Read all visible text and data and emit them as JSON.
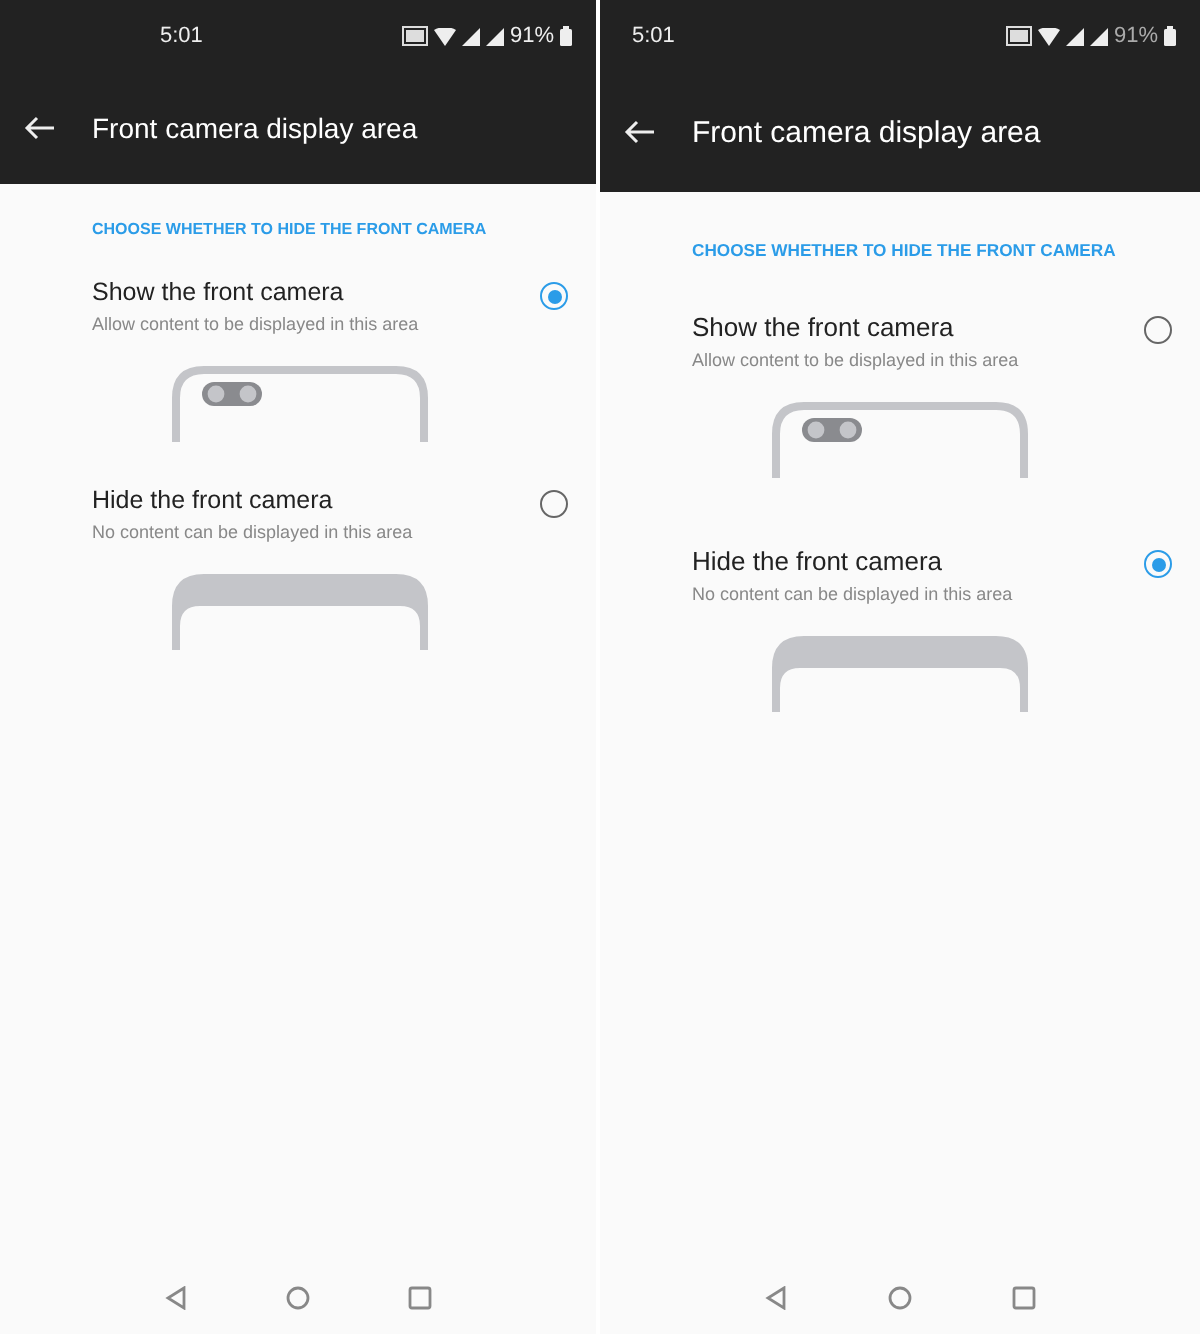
{
  "screens": [
    {
      "status_bar": {
        "time": "5:01",
        "battery": "91%"
      },
      "app_bar": {
        "title": "Front camera display area"
      },
      "section_header": "CHOOSE WHETHER TO HIDE THE FRONT CAMERA",
      "options": [
        {
          "kind": "show",
          "title": "Show the front camera",
          "subtitle": "Allow content to be displayed in this area",
          "selected": true
        },
        {
          "kind": "hide",
          "title": "Hide the front camera",
          "subtitle": "No content can be displayed in this area",
          "selected": false
        }
      ]
    },
    {
      "status_bar": {
        "time": "5:01",
        "battery": "91%"
      },
      "app_bar": {
        "title": "Front camera display area"
      },
      "section_header": "CHOOSE WHETHER TO HIDE THE FRONT CAMERA",
      "options": [
        {
          "kind": "show",
          "title": "Show the front camera",
          "subtitle": "Allow content to be displayed in this area",
          "selected": false
        },
        {
          "kind": "hide",
          "title": "Hide the front camera",
          "subtitle": "No content can be displayed in this area",
          "selected": true
        }
      ]
    }
  ]
}
